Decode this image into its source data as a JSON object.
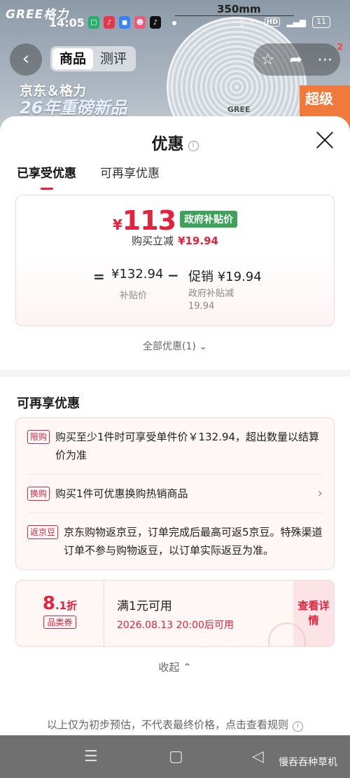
{
  "background": {
    "brand": "GREE格力",
    "dimension": "350mm",
    "fan_logo": "GREE",
    "banner_line1": "京东＆格力",
    "banner_line2": "26年重磅新品",
    "corner_text": "超级"
  },
  "status_bar": {
    "time": "14:05",
    "battery": "11",
    "hd": "HD"
  },
  "nav": {
    "tabs": [
      "商品",
      "测评"
    ],
    "badge": "2"
  },
  "sheet": {
    "title": "优惠",
    "tabs": [
      "已享受优惠",
      "可再享优惠"
    ],
    "price": {
      "yen": "¥",
      "final_price": "113",
      "gov_tag": "政府补贴价",
      "instant_label": "购买立减",
      "instant_value": "¥19.94",
      "eq": "=",
      "subsidy_price": "¥132.94",
      "subsidy_label": "补贴价",
      "minus": "−",
      "promo_value": "促销 ¥19.94",
      "promo_label": "政府补贴减 19.94"
    },
    "all_discount": "全部优惠(1)",
    "more_section_title": "可再享优惠",
    "promos": [
      {
        "tag": "限购",
        "text": "购买至少1件时可享受单件价￥132.94，超出数量以结算价为准"
      },
      {
        "tag": "换购",
        "text": "购买1件可优惠换购热销商品"
      },
      {
        "tag": "返京豆",
        "text": "京东购物返京豆，订单完成后最高可返5京豆。特殊渠道订单不参与购物返豆，以订单实际返豆为准。"
      }
    ],
    "coupon": {
      "discount_main": "8",
      "discount_sub": ".1折",
      "type": "品类券",
      "condition": "满1元可用",
      "expire": "2026.08.13 20:00后可用",
      "action": "查看详情"
    },
    "collapse": "收起",
    "disclaimer": "以上仅为初步预估，不代表最终价格，点击查看规则"
  },
  "watermark": "慢吞吞种草机",
  "colors": {
    "accent_red": "#e5213b",
    "gov_green": "#3ea35a"
  }
}
